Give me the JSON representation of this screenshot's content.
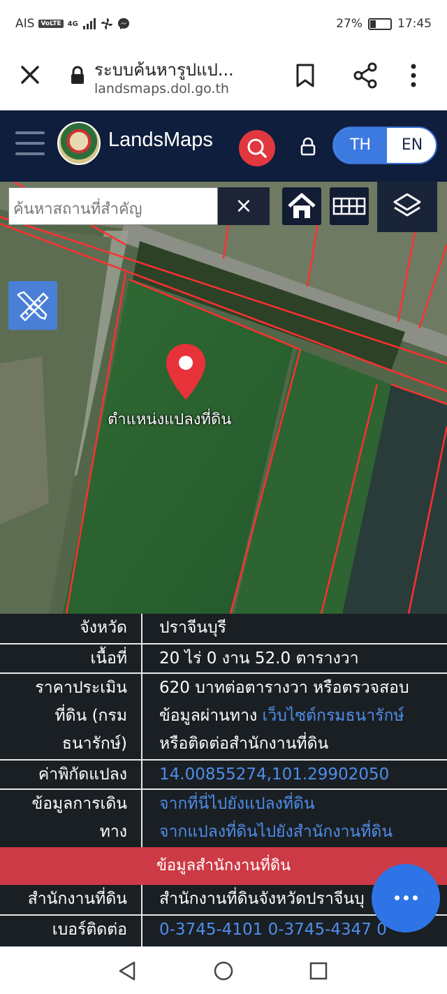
{
  "status_bar": {
    "carrier": "AIS",
    "volte": "VoLTE",
    "network": "4G",
    "battery": "27%",
    "battery_level": 0.27,
    "time": "17:45"
  },
  "browser": {
    "page_title": "ระบบค้นหารูปแป...",
    "url": "landsmaps.dol.go.th"
  },
  "app_header": {
    "brand": "LandsMaps",
    "lang_th": "TH",
    "lang_en": "EN"
  },
  "map": {
    "search_placeholder": "ค้นหาสถานที่สำคัญ",
    "clear_label": "×",
    "pin_label": "ตำแหน่งแปลงที่ดิน"
  },
  "info": {
    "province_label": "จังหวัด",
    "province_value": "ปราจีนบุรี",
    "area_label": "เนื้อที่",
    "area_value": "20 ไร่ 0 งาน 52.0 ตารางวา",
    "price_label_1": "ราคาประเมิน",
    "price_label_2": "ที่ดิน (กรม",
    "price_label_3": "ธนารักษ์)",
    "price_value_1": "620 บาทต่อตารางวา หรือตรวจสอบ",
    "price_value_2a": "ข้อมูลผ่านทาง ",
    "price_value_2_link": "เว็บไซต์กรมธนารักษ์",
    "price_value_3": "หรือติดต่อสำนักงานที่ดิน",
    "coords_label": "ค่าพิกัดแปลง",
    "coords_value": "14.00855274,101.29902050",
    "travel_label_1": "ข้อมูลการเดิน",
    "travel_label_2": "ทาง",
    "travel_link_1": "จากที่นี่ไปยังแปลงที่ดิน",
    "travel_link_2": "จากแปลงที่ดินไปยังสำนักงานที่ดิน",
    "office_header": "ข้อมูลสำนักงานที่ดิน",
    "office_label": "สำนักงานที่ดิน",
    "office_value": "สำนักงานที่ดินจังหวัดปราจีนบุ",
    "phone_label": "เบอร์ติดต่อ",
    "phone_value": "0-3745-4101 0-3745-4347 0"
  },
  "colors": {
    "header_bg": "#0e1e3c",
    "accent_red": "#e0383e",
    "accent_blue": "#3d7ae0",
    "table_bg": "#1a1f24",
    "link": "#4f8ee8"
  }
}
